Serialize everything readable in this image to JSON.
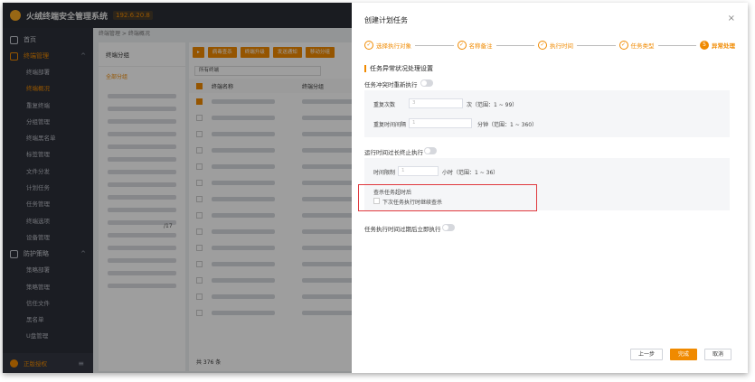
{
  "app": {
    "title": "火绒终端安全管理系统",
    "version": "192.6.20.8"
  },
  "sidebar": {
    "groups": [
      {
        "label": "首页",
        "items": []
      },
      {
        "label": "终端管理",
        "items": [
          "终端部署",
          "终端概况",
          "重复终端",
          "分组管理",
          "终端黑名单",
          "标签管理",
          "文件分发",
          "计划任务",
          "任务管理",
          "终端选项",
          "设备管理"
        ]
      },
      {
        "label": "防护策略",
        "items": [
          "策略部署",
          "策略管理",
          "信任文件",
          "黑名单",
          "U盘管理"
        ]
      }
    ],
    "active_item": "终端概况",
    "license_label": "正版授权"
  },
  "main": {
    "breadcrumb": "终端管理 > 终端概况",
    "tree_title": "终端分组",
    "tree_root": "全部分组",
    "toolbar": [
      "病毒查杀",
      "终端升级",
      "发送通知",
      "移动分组",
      "…"
    ],
    "filter": "所有终端",
    "table_headers": [
      "终端名称",
      "终端分组"
    ],
    "footer": "共 376 条",
    "partial_number": "/17"
  },
  "drawer": {
    "title": "创建计划任务",
    "close": "×",
    "steps": [
      {
        "label": "选择执行对象",
        "state": "done"
      },
      {
        "label": "名称备注",
        "state": "done"
      },
      {
        "label": "执行时间",
        "state": "done"
      },
      {
        "label": "任务类型",
        "state": "done"
      },
      {
        "label": "异常处理",
        "state": "current",
        "num": "5"
      }
    ],
    "section_title": "任务异常状况处理设置",
    "conflict_label": "任务冲突时重新执行",
    "retry_count_label": "重复次数",
    "retry_count_value": "3",
    "retry_count_hint": "次（范围：1 ~ 99）",
    "retry_interval_label": "重复时间间隔",
    "retry_interval_value": "1",
    "retry_interval_hint": "分钟（范围：1 ~ 360）",
    "timeout_label": "运行时间过长终止执行",
    "time_limit_label": "时间限制",
    "time_limit_value": "1",
    "time_limit_hint": "小时（范围：1 ~ 36）",
    "scan_timeout_label": "查杀任务超时后",
    "scan_continue_label": "下次任务执行时继续查杀",
    "expired_label": "任务执行时间过期后立即执行",
    "buttons": {
      "prev": "上一步",
      "finish": "完成",
      "cancel": "取消"
    }
  },
  "colors": {
    "accent": "#f08a00",
    "sidebar_bg": "#2d3039",
    "highlight": "#e0393e"
  }
}
